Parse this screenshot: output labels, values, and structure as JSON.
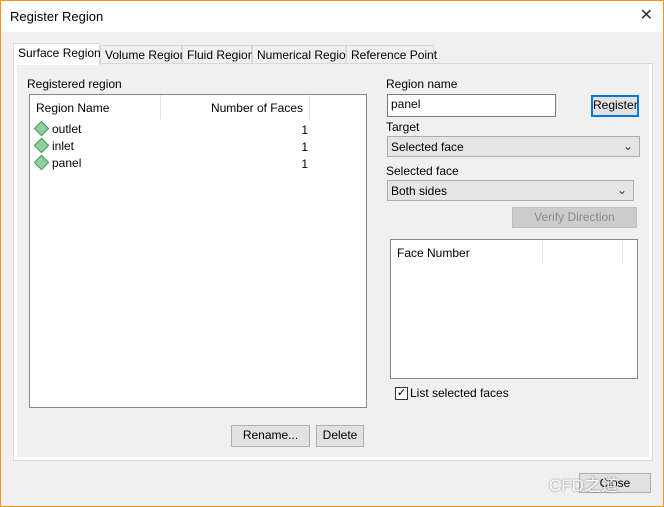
{
  "window": {
    "title": "Register Region",
    "close_icon": "close-icon"
  },
  "tabs": [
    {
      "label": "Surface Region",
      "active": true
    },
    {
      "label": "Volume Region"
    },
    {
      "label": "Fluid Region"
    },
    {
      "label": "Numerical Region"
    },
    {
      "label": "Reference Point"
    }
  ],
  "registered": {
    "label": "Registered region",
    "columns": [
      "Region Name",
      "Number of Faces"
    ],
    "rows": [
      {
        "name": "outlet",
        "faces": "1"
      },
      {
        "name": "inlet",
        "faces": "1"
      },
      {
        "name": "panel",
        "faces": "1"
      }
    ],
    "rename_label": "Rename...",
    "delete_label": "Delete"
  },
  "form": {
    "region_name_label": "Region name",
    "region_name_value": "panel",
    "register_label": "Register",
    "target_label": "Target",
    "target_value": "Selected face",
    "selected_face_label": "Selected face",
    "selected_face_value": "Both sides",
    "verify_label": "Verify Direction",
    "face_table_header": "Face Number",
    "list_selected_label": "List selected faces",
    "list_selected_checked": true
  },
  "footer": {
    "close_label": "Close"
  },
  "watermark": "CFD之道"
}
